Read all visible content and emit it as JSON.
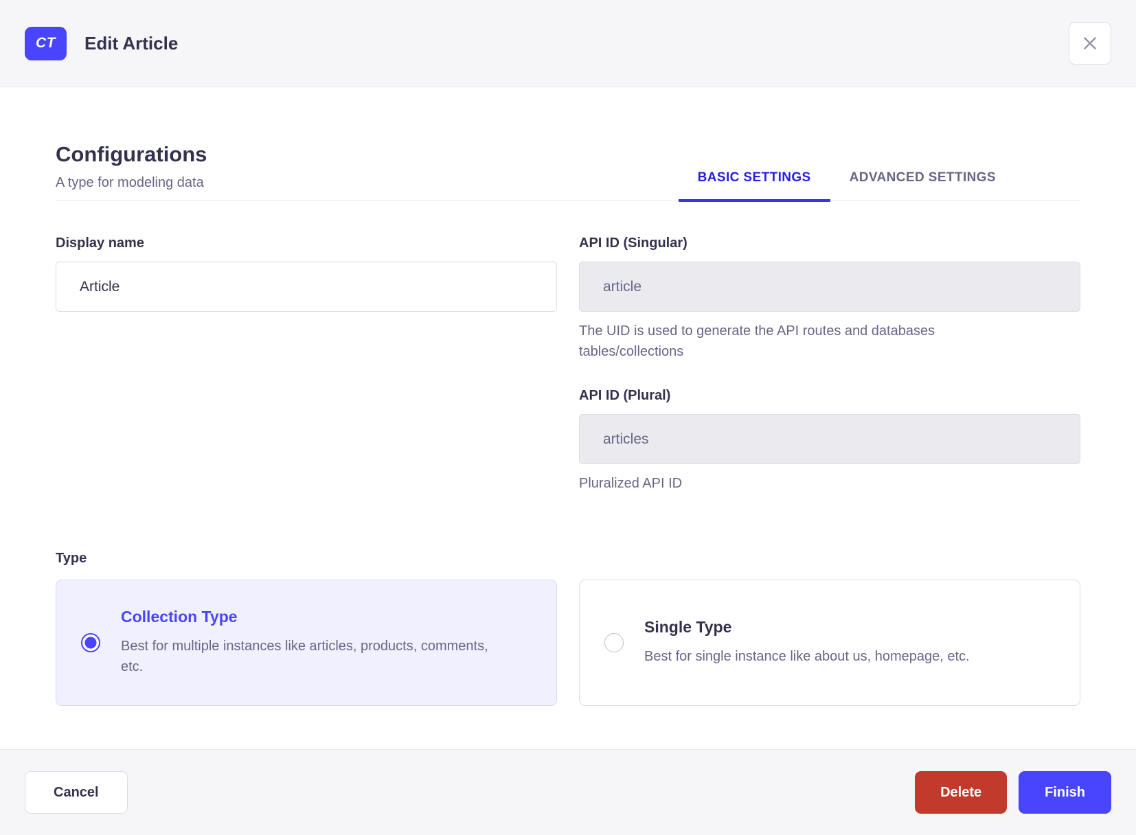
{
  "header": {
    "badge": "CT",
    "title": "Edit Article"
  },
  "intro": {
    "title": "Configurations",
    "subtitle": "A type for modeling data"
  },
  "tabs": [
    {
      "label": "BASIC SETTINGS",
      "active": true
    },
    {
      "label": "ADVANCED SETTINGS",
      "active": false
    }
  ],
  "form": {
    "display_name": {
      "label": "Display name",
      "value": "Article"
    },
    "api_id_singular": {
      "label": "API ID (Singular)",
      "value": "article",
      "hint": "The UID is used to generate the API routes and databases tables/collections"
    },
    "api_id_plural": {
      "label": "API ID (Plural)",
      "value": "articles",
      "hint": "Pluralized API ID"
    },
    "type": {
      "label": "Type",
      "options": [
        {
          "title": "Collection Type",
          "description": "Best for multiple instances like articles, products, comments, etc.",
          "selected": true
        },
        {
          "title": "Single Type",
          "description": "Best for single instance like about us, homepage, etc.",
          "selected": false
        }
      ]
    }
  },
  "footer": {
    "cancel": "Cancel",
    "delete": "Delete",
    "finish": "Finish"
  },
  "colors": {
    "primary": "#4945ff",
    "tab_active_text": "#271fe0",
    "danger": "#c13a2c",
    "selected_card_bg": "#f0f0ff",
    "header_footer_bg": "#f6f6f9",
    "text_dark": "#32324d",
    "text_muted": "#666687",
    "border_light": "#eaeaef",
    "border_input": "#dcdce4"
  }
}
